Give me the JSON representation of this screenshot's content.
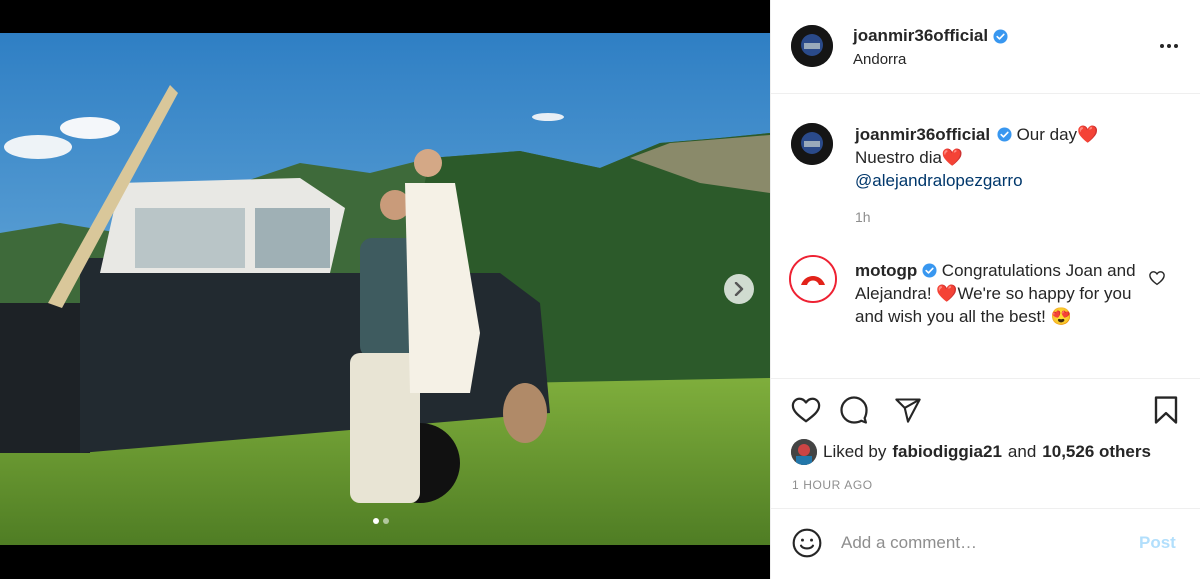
{
  "post": {
    "username": "joanmir36official",
    "location": "Andorra",
    "more_icon": "more-horizontal-icon",
    "caption_parts": {
      "line1": "Our day❤️",
      "line2": "Nuestro dia❤️",
      "mention": "@alejandralopezgarro"
    },
    "caption_time": "1h"
  },
  "comment": {
    "username": "motogp",
    "text": "Congratulations Joan and Alejandra! ❤️We're so happy for you and wish you all the best! 😍"
  },
  "actions": {
    "like_icon": "heart-icon",
    "comment_icon": "comment-icon",
    "share_icon": "send-icon",
    "save_icon": "bookmark-icon"
  },
  "likes": {
    "prefix": "Liked by",
    "user": "fabiodiggia21",
    "joiner": "and",
    "others": "10,526 others"
  },
  "time_ago": "1 HOUR AGO",
  "add_comment": {
    "placeholder": "Add a comment…",
    "post_label": "Post"
  },
  "colors": {
    "verified": "#3897f0",
    "link": "#00376b",
    "post_button_disabled": "#b2dffc",
    "muted": "#8e8e8e"
  }
}
